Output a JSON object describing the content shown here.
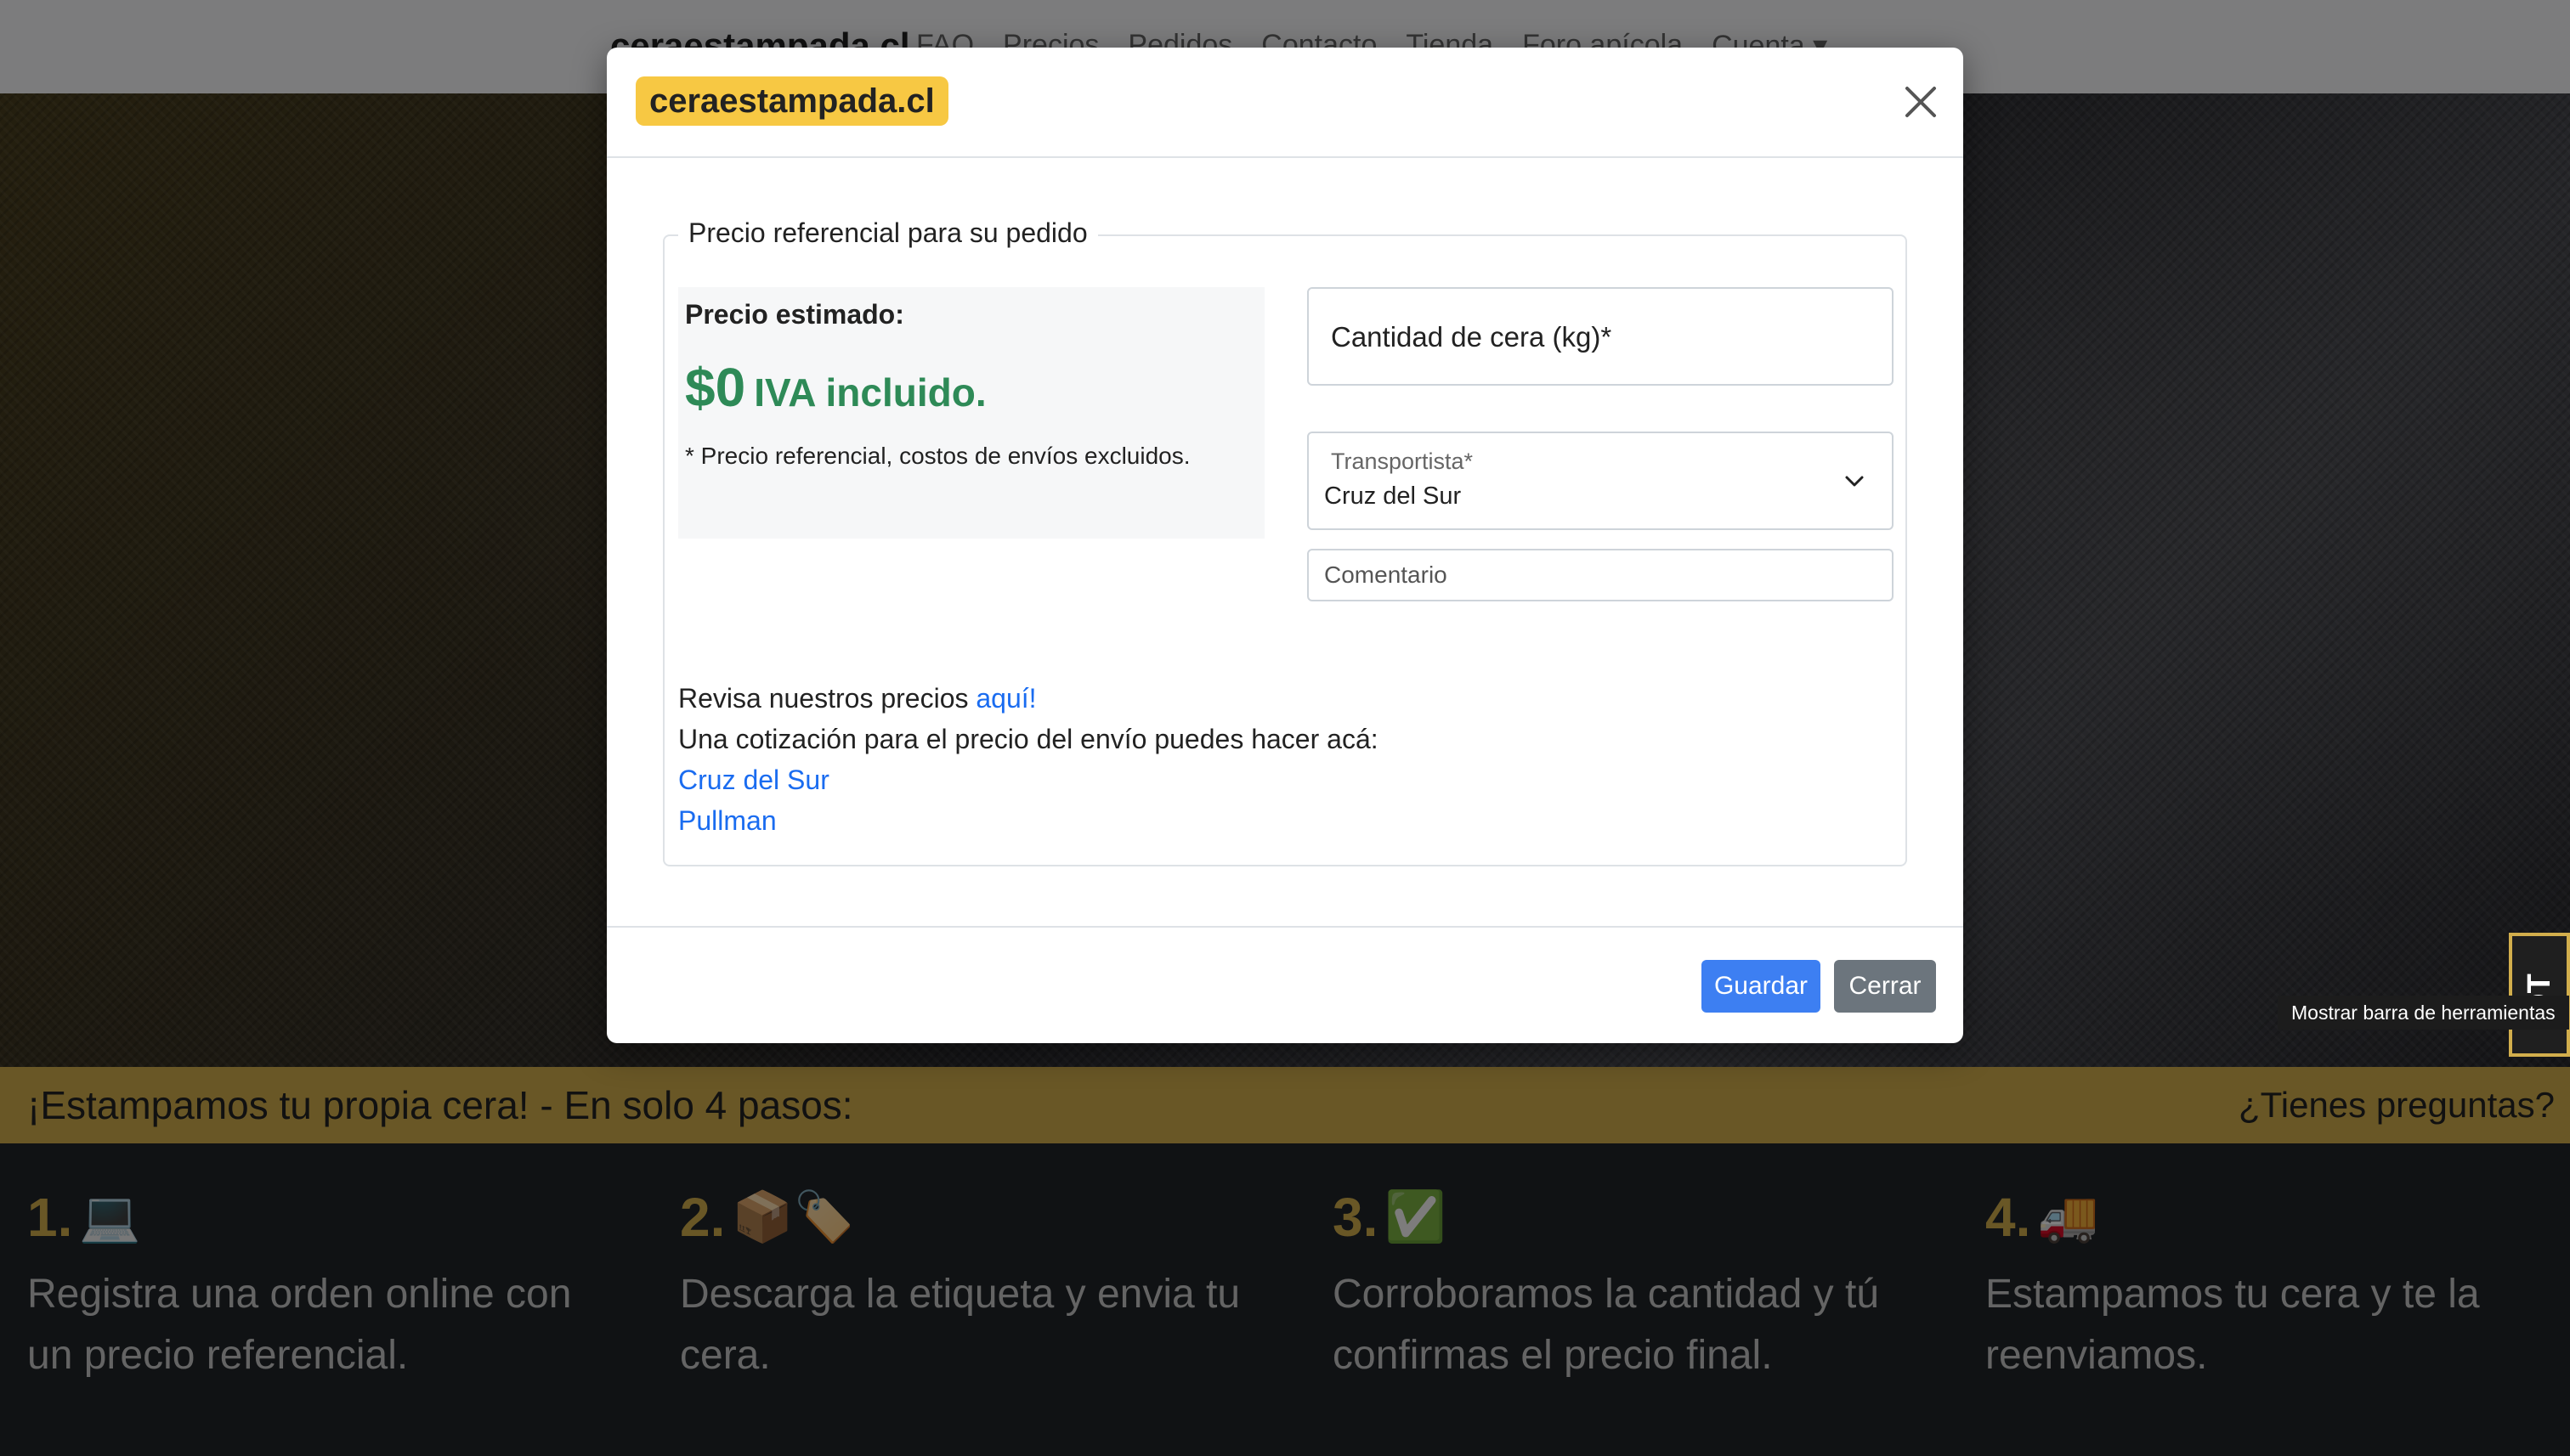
{
  "navbar": {
    "brand": "ceraestampada.cl",
    "links": [
      "FAQ",
      "Precios",
      "Pedidos",
      "Contacto",
      "Tienda",
      "Foro apícola",
      "Cuenta ▾"
    ]
  },
  "steps_bar": {
    "title": "¡Estampamos tu propia cera! - En solo 4 pasos:",
    "question": "¿Tienes preguntas?"
  },
  "steps": [
    {
      "number": "1.",
      "emoji": "💻",
      "text": "Registra una orden online con un precio referencial."
    },
    {
      "number": "2.",
      "emoji": "📦🏷️",
      "text": "Descarga la etiqueta y envia tu cera."
    },
    {
      "number": "3.",
      "emoji": "✅",
      "text": "Corroboramos la cantidad y tú confirmas el precio final."
    },
    {
      "number": "4.",
      "emoji": "🚚",
      "text": "Estampamos tu cera y te la reenviamos."
    }
  ],
  "debug_toolbar": {
    "tab_label": "DT",
    "tooltip": "Mostrar barra de herramientas"
  },
  "modal": {
    "brand": "ceraestampada.cl",
    "close_icon": "×",
    "legend": "Precio referencial para su pedido",
    "estimate": {
      "label": "Precio estimado:",
      "amount": "$0",
      "iva": "IVA incluido.",
      "note": "* Precio referencial, costos de envíos excluidos."
    },
    "quantity_placeholder": "Cantidad de cera (kg)*",
    "carrier": {
      "label": "Transportista*",
      "value": "Cruz del Sur"
    },
    "comment_placeholder": "Comentario",
    "info": {
      "prices_text": "Revisa nuestros precios ",
      "prices_link": "aquí!",
      "shipping_text": "Una cotización para el precio del envío puedes hacer acá:",
      "links": [
        "Cruz del Sur",
        "Pullman"
      ]
    },
    "save_label": "Guardar",
    "close_label": "Cerrar"
  },
  "colors": {
    "accent_gold": "#d2ae4c",
    "price_green": "#2e8a57",
    "link_blue": "#1a6cf0",
    "primary_button": "#3d7ff2",
    "secondary_button": "#6c757d"
  }
}
